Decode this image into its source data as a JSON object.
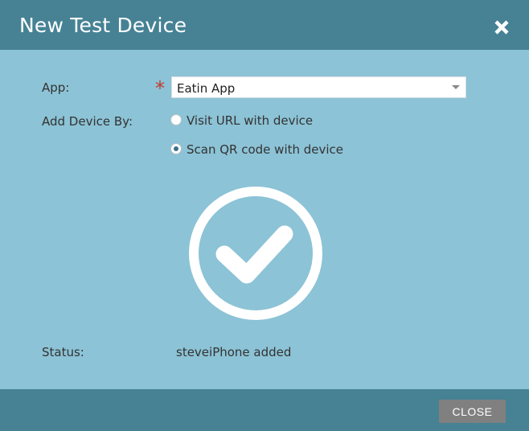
{
  "dialog": {
    "title": "New Test Device",
    "close_icon": "close-x-icon"
  },
  "form": {
    "app_label": "App:",
    "required_marker": "*",
    "app_value": "Eatin App",
    "add_device_label": "Add Device By:",
    "options": [
      {
        "label": "Visit URL with device",
        "selected": false
      },
      {
        "label": "Scan QR code with device",
        "selected": true
      }
    ]
  },
  "success_icon": "check-circle-icon",
  "status": {
    "label": "Status:",
    "value": "steveiPhone added"
  },
  "footer": {
    "close_label": "CLOSE"
  },
  "colors": {
    "header": "#468294",
    "body": "#8cc3d6",
    "button": "#808080",
    "required": "#c0392b"
  }
}
